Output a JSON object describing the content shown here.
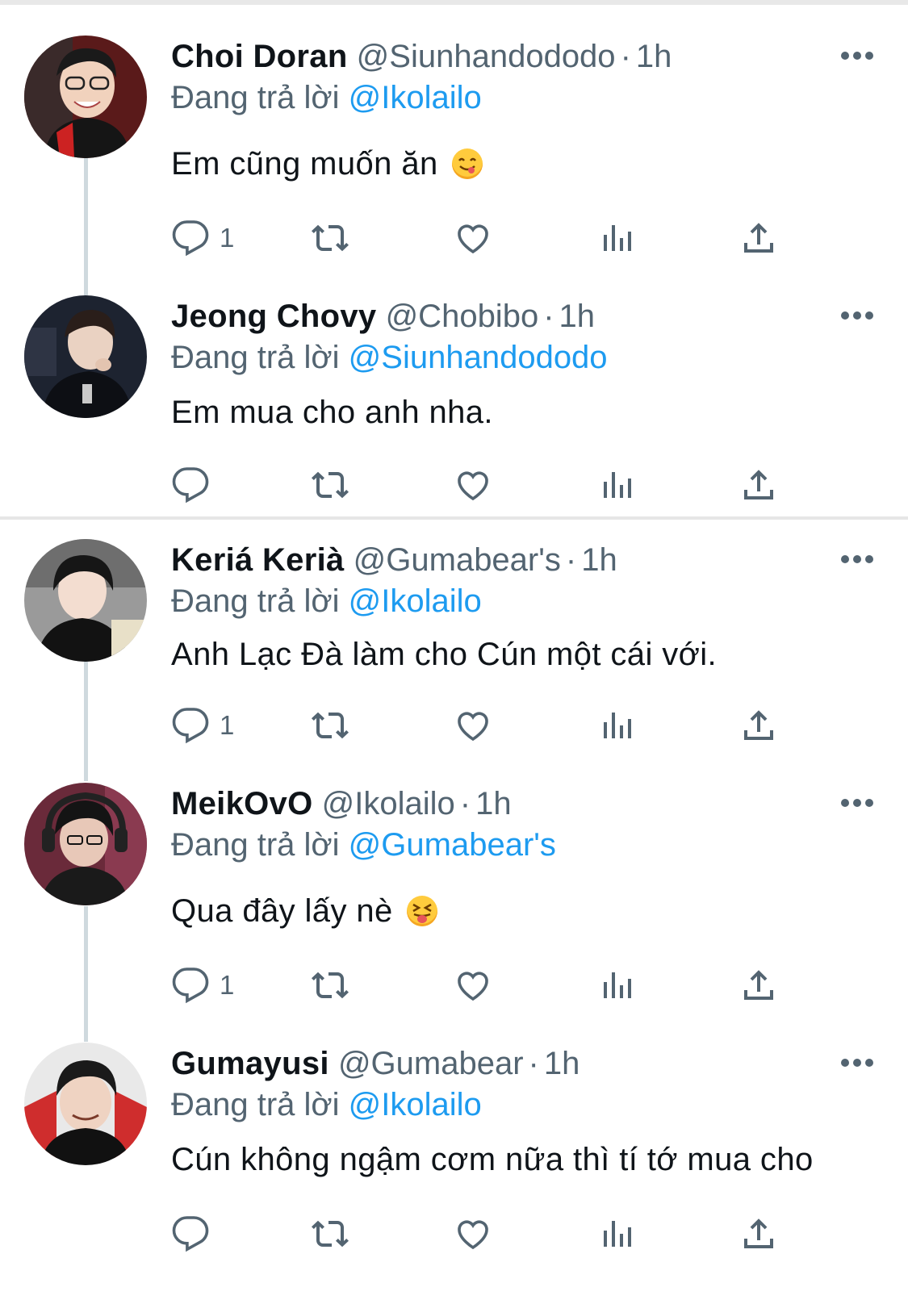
{
  "tweets": [
    {
      "name": "Choi Doran",
      "handle": "@Siunhandododo",
      "time": "1h",
      "replying_label": "Đang trả lời",
      "replying_to": "@Ikolailo",
      "text": "Em cũng muốn ăn",
      "emoji": "savoring-food-emoji",
      "reply_count": "1"
    },
    {
      "name": "Jeong Chovy",
      "handle": "@Chobibo",
      "time": "1h",
      "replying_label": "Đang trả lời",
      "replying_to": "@Siunhandododo",
      "text": "Em mua cho anh nha.",
      "emoji": "",
      "reply_count": ""
    },
    {
      "name": "Keriá Kerià",
      "handle": "@Gumabear's",
      "time": "1h",
      "replying_label": "Đang trả lời",
      "replying_to": "@Ikolailo",
      "text": "Anh Lạc Đà làm cho Cún một cái với.",
      "emoji": "",
      "reply_count": "1"
    },
    {
      "name": "MeikOvO",
      "handle": "@Ikolailo",
      "time": "1h",
      "replying_label": "Đang trả lời",
      "replying_to": "@Gumabear's",
      "text": "Qua đây lấy nè",
      "emoji": "squinting-tongue-emoji",
      "reply_count": "1"
    },
    {
      "name": "Gumayusi",
      "handle": "@Gumabear",
      "time": "1h",
      "replying_label": "Đang trả lời",
      "replying_to": "@Ikolailo",
      "text": "Cún không ngậm cơm nữa thì tí tớ mua cho",
      "emoji": "",
      "reply_count": ""
    }
  ],
  "icons": {
    "reply": "reply-icon",
    "retweet": "retweet-icon",
    "like": "heart-icon",
    "views": "analytics-icon",
    "share": "share-icon",
    "more": "more-icon"
  },
  "colors": {
    "link": "#1d9bf0",
    "secondary_text": "#536471",
    "primary_text": "#0f1419",
    "thread_line": "#cfd9de"
  }
}
